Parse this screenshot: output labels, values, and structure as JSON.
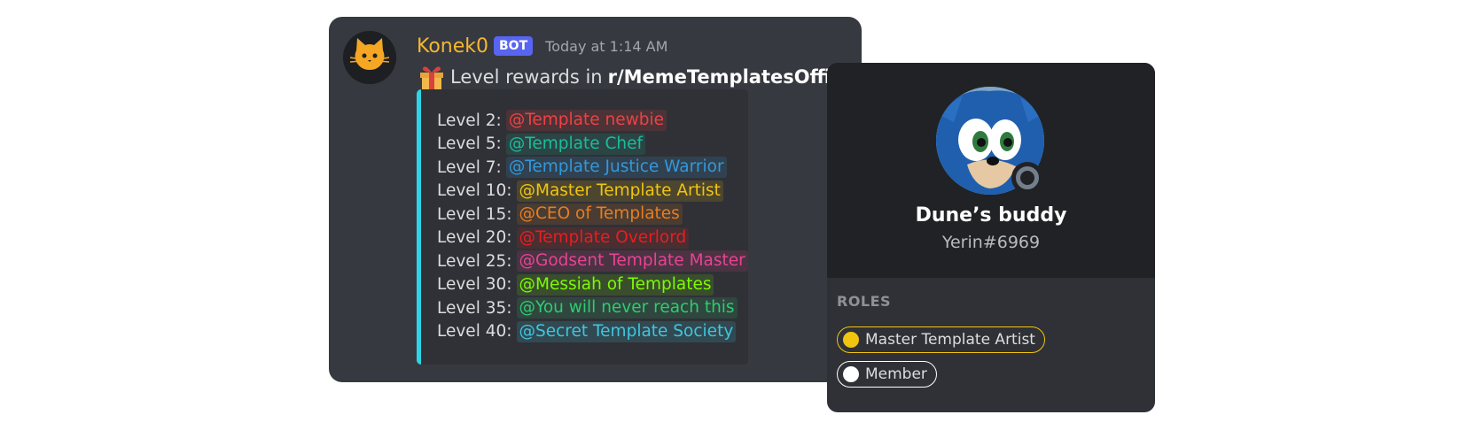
{
  "message": {
    "username": "Konek0",
    "bot_tag": "BOT",
    "timestamp": "Today at 1:14 AM",
    "text_prefix": "Level rewards in",
    "text_bold": "r/MemeTemplatesOfficial",
    "embed_accent": "#2dd5e6",
    "levels": [
      {
        "label": "Level 2:",
        "role": "@Template newbie",
        "color": "#ed4245",
        "bg": "rgba(237,66,69,0.15)"
      },
      {
        "label": "Level 5:",
        "role": "@Template Chef",
        "color": "#1abc9c",
        "bg": "rgba(26,188,156,0.15)"
      },
      {
        "label": "Level 7:",
        "role": "@Template Justice Warrior",
        "color": "#3498db",
        "bg": "rgba(52,152,219,0.17)"
      },
      {
        "label": "Level 10:",
        "role": "@Master Template Artist",
        "color": "#f1c40f",
        "bg": "rgba(241,196,15,0.15)"
      },
      {
        "label": "Level 15:",
        "role": "@CEO of Templates",
        "color": "#e67e22",
        "bg": "rgba(230,126,34,0.15)"
      },
      {
        "label": "Level 20:",
        "role": "@Template Overlord",
        "color": "#e91e1e",
        "bg": "rgba(233,30,30,0.14)"
      },
      {
        "label": "Level 25:",
        "role": "@Godsent Template Master",
        "color": "#e84393",
        "bg": "rgba(232,67,147,0.15)"
      },
      {
        "label": "Level 30:",
        "role": "@Messiah of Templates",
        "color": "#7cfc00",
        "bg": "rgba(124,252,0,0.14)"
      },
      {
        "label": "Level 35:",
        "role": "@You will never reach this",
        "color": "#2ecc71",
        "bg": "rgba(46,204,113,0.15)"
      },
      {
        "label": "Level 40:",
        "role": "@Secret Template Society",
        "color": "#3ec6e0",
        "bg": "rgba(62,198,224,0.16)"
      }
    ]
  },
  "profile": {
    "display_name": "Dune’s buddy",
    "user_tag": "Yerin#6969",
    "roles_title": "ROLES",
    "roles": [
      {
        "name": "Master Template Artist",
        "color": "#f1c40f"
      },
      {
        "name": "Member",
        "color": "#ffffff"
      }
    ]
  }
}
